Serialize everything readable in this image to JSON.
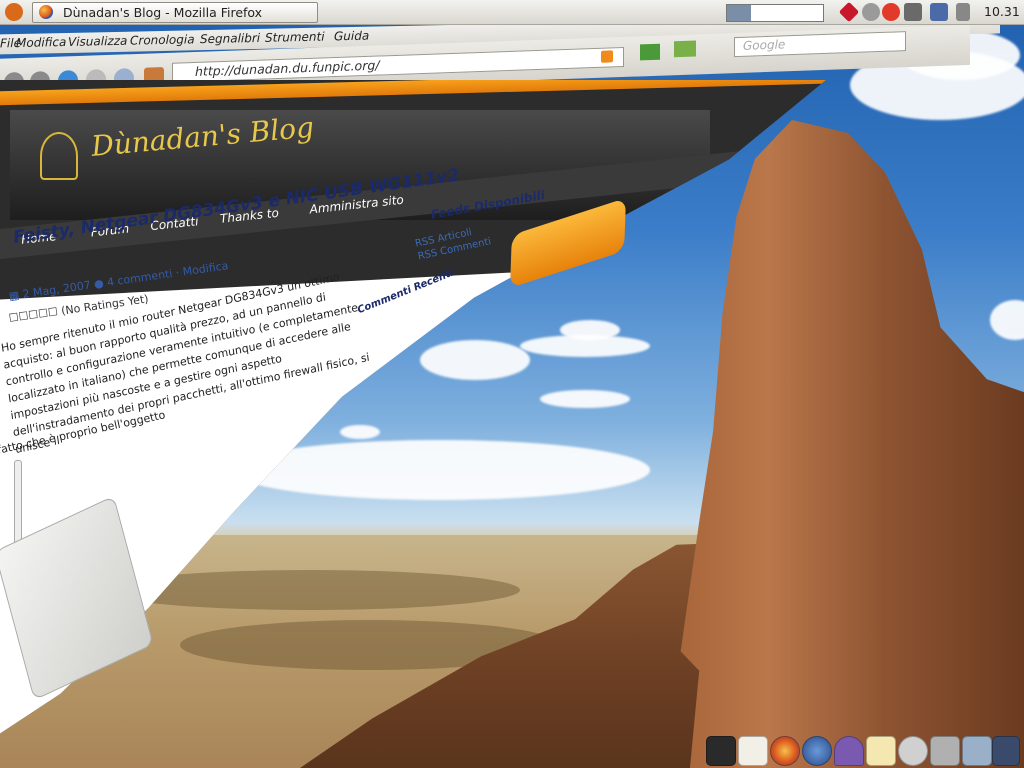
{
  "top_panel": {
    "window_title": "Dùnadan's Blog - Mozilla Firefox",
    "clock": "10.31"
  },
  "browser": {
    "menu": [
      "File",
      "Modifica",
      "Visualizza",
      "Cronologia",
      "Segnalibri",
      "Strumenti",
      "Guida"
    ],
    "url": "http://dunadan.du.funpic.org/",
    "search_placeholder": "Google"
  },
  "blog": {
    "title": "Dùnadan's Blog",
    "nav": [
      "Home",
      "Forum",
      "Contatti",
      "Thanks to",
      "Amministra sito"
    ],
    "post_title": "Feisty, Netgear DG834Gv3 e NIC USB WG111v2",
    "post_date": "2 Mag, 2007",
    "post_comments": "4 commenti",
    "post_edit": "Modifica",
    "ratings": "(No Ratings Yet)",
    "body": "Ho sempre ritenuto il mio router Netgear DG834Gv3 un ottimo acquisto: al buon rapporto qualità prezzo, ad un pannello di controllo e configurazione veramente intuitivo (e completamente localizzato in italiano) che permette comunque di accedere alle impostazioni più nascoste e a gestire ogni aspetto dell'instradamento dei propri pacchetti, all'ottimo firewall fisico, si unisce il",
    "body_tail": "fatto che è proprio bell'oggetto",
    "sidebar": {
      "feeds_title": "Feeds Disponibili",
      "feeds": [
        "RSS Articoli",
        "RSS Commenti"
      ],
      "comments_title": "Commenti Recenti"
    }
  },
  "colors": {
    "accent_orange": "#f7a21c",
    "header_dark": "#2c2c2c",
    "title_gold": "#e8c84a",
    "link_blue": "#335ba8"
  },
  "dock": [
    "terminal-icon",
    "text-editor-icon",
    "firefox-icon",
    "thunderbird-icon",
    "pidgin-icon",
    "notes-icon",
    "media-icon",
    "file-manager-icon",
    "settings-icon",
    "network-icon"
  ]
}
